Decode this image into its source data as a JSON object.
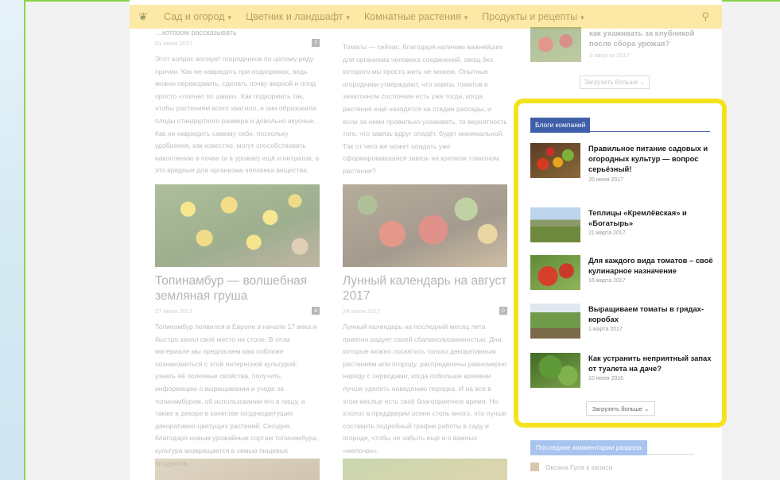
{
  "nav": {
    "items": [
      {
        "label": "Сад и огород"
      },
      {
        "label": "Цветник и ландшафт"
      },
      {
        "label": "Комнатные растения"
      },
      {
        "label": "Продукты и рецепты"
      }
    ]
  },
  "articles": {
    "a1": {
      "title_partial": "…котором рассказывать",
      "date": "01 июня 2017",
      "comments": "7",
      "text": "Этот вопрос волнует огородников по целому ряду причин. Как не навредить при подкормках, ведь можно перекормить, сделать почву жирной и плод просто «лопнет по швам». Как подкормить так, чтобы растениям всего хватило, и они образовали плоды стандартного размера и довольно вкусные. Как не навредить самому себе, поскольку удобрения, как известно, могут способствовать накоплению в почве (и в урожае) ещё и нитратов, а это вредные для организма человека вещества."
    },
    "a2": {
      "text": "Томаты — сейчас, благодаря наличию важнейших для организма человека соединений, овощ без которого мы просто жить не можем. Опытные огородники утверждают, что завязь томатов в зачаточном состоянии есть уже тогда, когда растения ещё находятся на стадии рассады, и если за ними правильно ухаживать, то вероятность того, что завязь вдруг опадёт, будет минимальной. Так от чего же может опадать уже сформировавшаяся завязь на крепком томатном растении?"
    },
    "a3": {
      "title": "Топинамбур — волшебная земляная груша",
      "date": "27 июля 2017",
      "comments": "4",
      "text": "Топинамбур появился в Европе в начале 17 века и быстро занял своё место на столе. В этом материале мы предлагаем вам поближе познакомиться с этой интересной культурой: узнать её полезные свойства, получить информацию о выращивании и уходе за топинамбуром, об использовании его в пищу, а также в декоре в качестве позднецветущих декоративно-цветущих растений. Сегодня, благодаря новым урожайным сортам топинамбура, культура возвращается в семью пищевых продуктов."
    },
    "a4": {
      "title": "Лунный календарь на август 2017",
      "date": "24 июля 2017",
      "comments": "0",
      "text": "Лунный календарь на последний месяц лета приятно радует своей сбалансированностью. Дни, которые можно посвятить только декоративным растениям или огороду, распределены равномерно наряду с периодами, когда побольше времени лучше уделять наведению порядка. И на все в этом месяце есть своё благоприятное время. Но хлопот в преддверии осени столь много, что лучше составить подробный график работы в саду и огороде, чтобы не забыть ещё и о важных «мелочах»."
    }
  },
  "sidebar_top": {
    "title": "как ухаживать за клубникой после сбора урожая?",
    "date": "3 августа 2017",
    "load_more": "Загрузить больше"
  },
  "company_blogs": {
    "tab": "Блоги компаний",
    "posts": [
      {
        "title": "Правильное питание садовых и огородных культур — вопрос серьёзный!",
        "date": "20 июня 2017"
      },
      {
        "title": "Теплицы «Кремлёвская» и «Богатырь»",
        "date": "21 марта 2017"
      },
      {
        "title": "Для каждого вида томатов – своё кулинарное назначение",
        "date": "16 марта 2017"
      },
      {
        "title": "Выращиваем томаты в грядах-коробах",
        "date": "1 марта 2017"
      },
      {
        "title": "Как устранить неприятный запах от туалета на даче?",
        "date": "10 июня 2016"
      }
    ],
    "load_more": "Загрузить больше"
  },
  "comments": {
    "tab": "Последние комментарии раздела",
    "first": "Оксана Гула к записи"
  },
  "colors": {
    "nav_bg": "#fde9a6",
    "highlight_border": "#f4e21c",
    "blogs_tab": "#3f5faa"
  }
}
